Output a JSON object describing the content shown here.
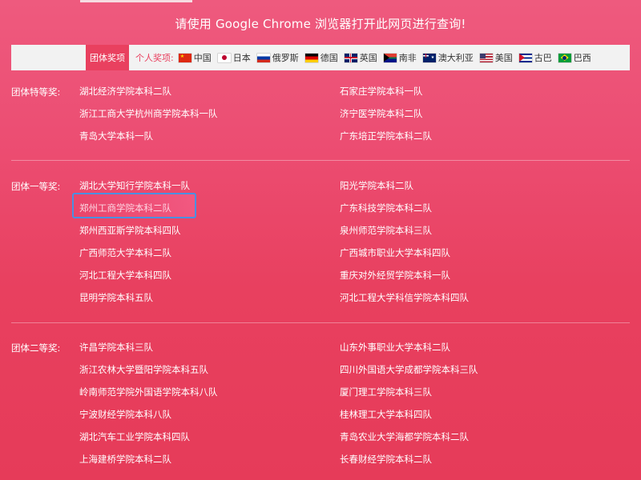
{
  "notice": "请使用 Google Chrome 浏览器打开此网页进行查询!",
  "filter": {
    "team_tab": "团体奖项",
    "individual_label": "个人奖项:",
    "countries": [
      {
        "name": "中国",
        "icon": "china-flag-icon"
      },
      {
        "name": "日本",
        "icon": "japan-flag-icon"
      },
      {
        "name": "俄罗斯",
        "icon": "russia-flag-icon"
      },
      {
        "name": "德国",
        "icon": "germany-flag-icon"
      },
      {
        "name": "英国",
        "icon": "uk-flag-icon"
      },
      {
        "name": "南非",
        "icon": "south-africa-flag-icon"
      },
      {
        "name": "澳大利亚",
        "icon": "australia-flag-icon"
      },
      {
        "name": "美国",
        "icon": "usa-flag-icon"
      },
      {
        "name": "古巴",
        "icon": "cuba-flag-icon"
      },
      {
        "name": "巴西",
        "icon": "brazil-flag-icon"
      }
    ]
  },
  "sections": {
    "special": {
      "label": "团体特等奖:",
      "left": [
        "湖北经济学院本科二队",
        "浙江工商大学杭州商学院本科一队",
        "青岛大学本科一队"
      ],
      "right": [
        "石家庄学院本科一队",
        "济宁医学院本科二队",
        "广东培正学院本科二队"
      ]
    },
    "first": {
      "label": "团体一等奖:",
      "left": [
        "湖北大学知行学院本科一队",
        "郑州工商学院本科二队",
        "郑州西亚斯学院本科四队",
        "广西师范大学本科二队",
        "河北工程大学本科四队",
        "昆明学院本科五队"
      ],
      "right": [
        "阳光学院本科二队",
        "广东科技学院本科二队",
        "泉州师范学院本科三队",
        "广西城市职业大学本科四队",
        "重庆对外经贸学院本科一队",
        "河北工程大学科信学院本科四队"
      ]
    },
    "second": {
      "label": "团体二等奖:",
      "left": [
        "许昌学院本科三队",
        "浙江农林大学暨阳学院本科五队",
        "岭南师范学院外国语学院本科八队",
        "宁波财经学院本科八队",
        "湖北汽车工业学院本科四队",
        "上海建桥学院本科二队"
      ],
      "right": [
        "山东外事职业大学本科二队",
        "四川外国语大学成都学院本科三队",
        "厦门理工学院本科三队",
        "桂林理工大学本科四队",
        "青岛农业大学海都学院本科二队",
        "长春财经学院本科二队"
      ]
    }
  }
}
